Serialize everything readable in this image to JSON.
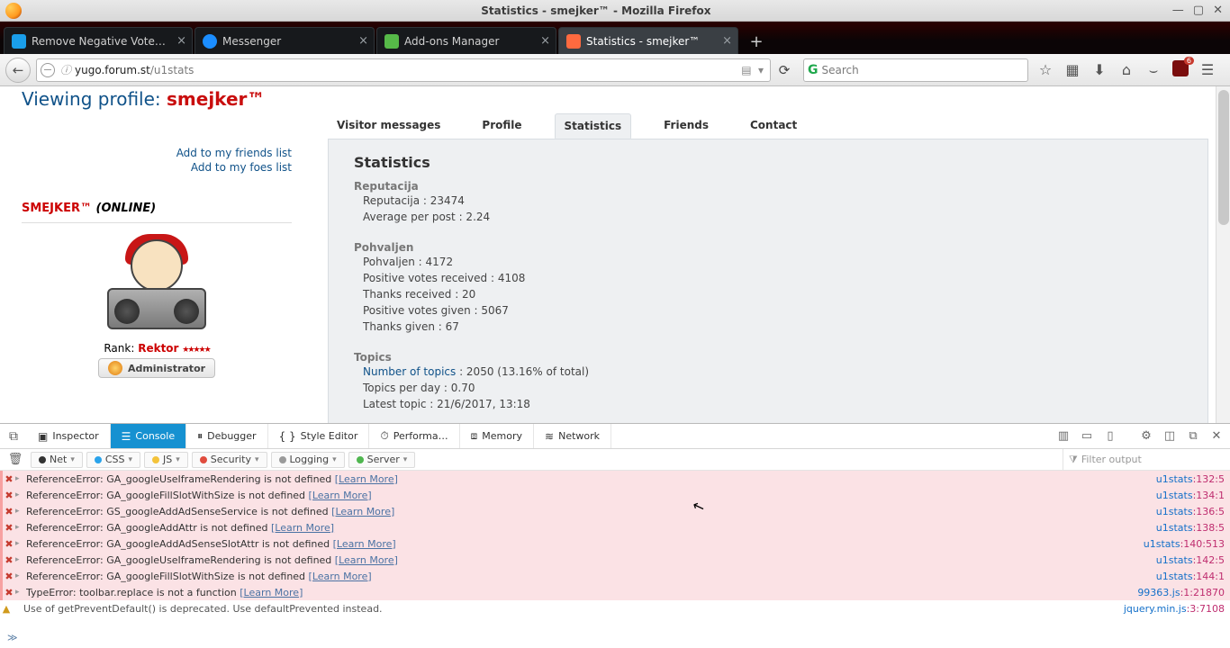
{
  "window": {
    "title": "Statistics - smejker™ - Mozilla Firefox"
  },
  "tabs": [
    {
      "label": "Remove Negative Votes …",
      "ico": "blue"
    },
    {
      "label": "Messenger",
      "ico": "bubble"
    },
    {
      "label": "Add-ons Manager",
      "ico": "puzzle"
    },
    {
      "label": "Statistics - smejker™",
      "ico": "heart",
      "active": true
    }
  ],
  "url": {
    "domain": "yugo.forum.st",
    "path": "/u1stats"
  },
  "search": {
    "placeholder": "Search"
  },
  "ublock_count": "6",
  "profile": {
    "viewing_prefix": "Viewing profile: ",
    "username": "smejker™",
    "add_friends": "Add to my friends list",
    "add_foes": "Add to my foes list",
    "name_upper": "SMEJKER™",
    "status": "(ONLINE)",
    "rank_label": "Rank:",
    "rank_value": "Rektor",
    "admin_label": "Administrator"
  },
  "page_tabs": [
    "Visitor messages",
    "Profile",
    "Statistics",
    "Friends",
    "Contact"
  ],
  "stats": {
    "heading": "Statistics",
    "sections": [
      {
        "title": "Reputacija",
        "rows": [
          {
            "k": "Reputacija :",
            "v": "23474"
          },
          {
            "k": "Average per post :",
            "v": "2.24"
          }
        ]
      },
      {
        "title": "Pohvaljen",
        "rows": [
          {
            "k": "Pohvaljen :",
            "v": "4172"
          },
          {
            "k": "Positive votes received :",
            "v": "4108"
          },
          {
            "k": "Thanks received :",
            "v": "20"
          },
          {
            "k": "Positive votes given :",
            "v": "5067"
          },
          {
            "k": "Thanks given :",
            "v": "67"
          }
        ]
      },
      {
        "title": "Topics",
        "rows": [
          {
            "k": "Number of topics",
            "v": ":  2050 (13.16% of total)",
            "link": true
          },
          {
            "k": "Topics per day :",
            "v": "0.70"
          },
          {
            "k": "Latest topic :",
            "v": "21/6/2017, 13:18"
          }
        ]
      }
    ]
  },
  "devtools": {
    "tabs": [
      "Inspector",
      "Console",
      "Debugger",
      "Style Editor",
      "Performa…",
      "Memory",
      "Network"
    ],
    "active_tab": "Console",
    "chips": [
      "Net",
      "CSS",
      "JS",
      "Security",
      "Logging",
      "Server"
    ],
    "filter_placeholder": "Filter output",
    "errors": [
      {
        "t": "err",
        "msg": "ReferenceError: GA_googleUseIframeRendering is not defined",
        "learn": "[Learn More]",
        "loc": "u1stats",
        "ln": ":132:5"
      },
      {
        "t": "err",
        "msg": "ReferenceError: GA_googleFillSlotWithSize is not defined",
        "learn": "[Learn More]",
        "loc": "u1stats",
        "ln": ":134:1"
      },
      {
        "t": "err",
        "msg": "ReferenceError: GS_googleAddAdSenseService is not defined",
        "learn": "[Learn More]",
        "loc": "u1stats",
        "ln": ":136:5"
      },
      {
        "t": "err",
        "msg": "ReferenceError: GA_googleAddAttr is not defined",
        "learn": "[Learn More]",
        "loc": "u1stats",
        "ln": ":138:5"
      },
      {
        "t": "err",
        "msg": "ReferenceError: GA_googleAddAdSenseSlotAttr is not defined",
        "learn": "[Learn More]",
        "loc": "u1stats",
        "ln": ":140:513"
      },
      {
        "t": "err",
        "msg": "ReferenceError: GA_googleUseIframeRendering is not defined",
        "learn": "[Learn More]",
        "loc": "u1stats",
        "ln": ":142:5"
      },
      {
        "t": "err",
        "msg": "ReferenceError: GA_googleFillSlotWithSize is not defined",
        "learn": "[Learn More]",
        "loc": "u1stats",
        "ln": ":144:1"
      },
      {
        "t": "err",
        "msg": "TypeError: toolbar.replace is not a function",
        "learn": "[Learn More]",
        "loc": "99363.js",
        "ln": ":1:21870"
      },
      {
        "t": "warn",
        "msg": "Use of getPreventDefault() is deprecated. Use defaultPrevented instead.",
        "learn": "",
        "loc": "jquery.min.js",
        "ln": ":3:7108"
      }
    ]
  }
}
